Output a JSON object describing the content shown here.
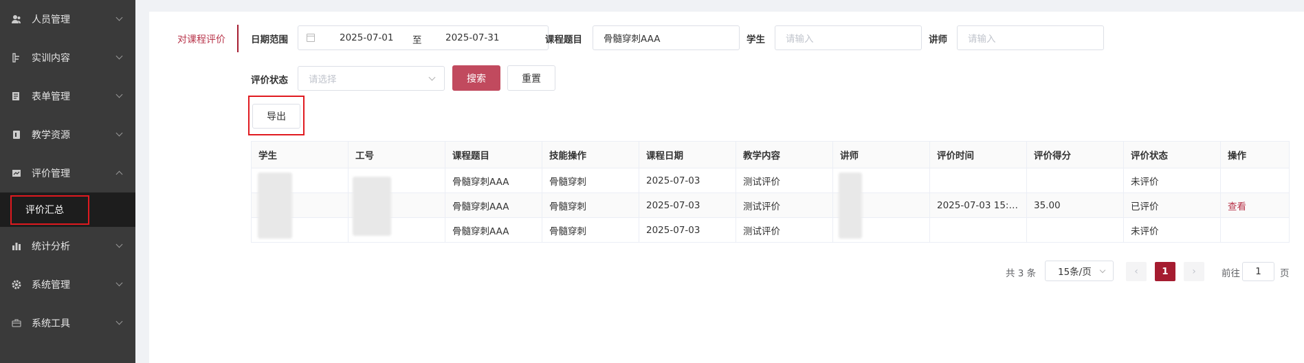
{
  "sidebar": {
    "items": [
      {
        "label": "人员管理",
        "icon": "users-icon"
      },
      {
        "label": "实训内容",
        "icon": "content-icon"
      },
      {
        "label": "表单管理",
        "icon": "form-icon"
      },
      {
        "label": "教学资源",
        "icon": "resource-icon"
      },
      {
        "label": "评价管理",
        "icon": "evaluation-icon",
        "expanded": true
      },
      {
        "label": "统计分析",
        "icon": "bar-chart-icon"
      },
      {
        "label": "系统管理",
        "icon": "gear-icon"
      },
      {
        "label": "系统工具",
        "icon": "toolbox-icon"
      }
    ],
    "sub_item": {
      "label": "评价汇总",
      "active": true
    }
  },
  "tab": {
    "label": "对课程评价"
  },
  "filters": {
    "date_range_label": "日期范围",
    "date_start": "2025-07-01",
    "date_separator": "至",
    "date_end": "2025-07-31",
    "course_label": "课程题目",
    "course_value": "骨髓穿刺AAA",
    "student_label": "学生",
    "student_placeholder": "请输入",
    "teacher_label": "讲师",
    "teacher_placeholder": "请输入",
    "status_label": "评价状态",
    "status_placeholder": "请选择",
    "search_button": "搜索",
    "reset_button": "重置"
  },
  "toolbar": {
    "export_button": "导出"
  },
  "table": {
    "columns": [
      "学生",
      "工号",
      "课程题目",
      "技能操作",
      "课程日期",
      "教学内容",
      "讲师",
      "评价时间",
      "评价得分",
      "评价状态",
      "操作"
    ],
    "rows": [
      {
        "student": "",
        "id": "",
        "course": "骨髓穿刺AAA",
        "skill": "骨髓穿刺",
        "date": "2025-07-03",
        "content": "测试评价",
        "teacher": "",
        "eval_time": "",
        "score": "",
        "status": "未评价",
        "action": ""
      },
      {
        "student": "",
        "id": "",
        "course": "骨髓穿刺AAA",
        "skill": "骨髓穿刺",
        "date": "2025-07-03",
        "content": "测试评价",
        "teacher": "",
        "eval_time": "2025-07-03 15:2...",
        "score": "35.00",
        "status": "已评价",
        "action": "查看"
      },
      {
        "student": "",
        "id": "",
        "course": "骨髓穿刺AAA",
        "skill": "骨髓穿刺",
        "date": "2025-07-03",
        "content": "测试评价",
        "teacher": "",
        "eval_time": "",
        "score": "",
        "status": "未评价",
        "action": ""
      }
    ]
  },
  "pagination": {
    "total": "共 3 条",
    "page_size": "15条/页",
    "current_page": "1",
    "goto_prefix": "前往",
    "goto_value": "1",
    "goto_suffix": "页",
    "prev": "‹",
    "next": "›"
  },
  "colors": {
    "accent": "#a51c30",
    "sidebar_bg": "#3a3a3a",
    "highlight_box": "#e0191f"
  }
}
